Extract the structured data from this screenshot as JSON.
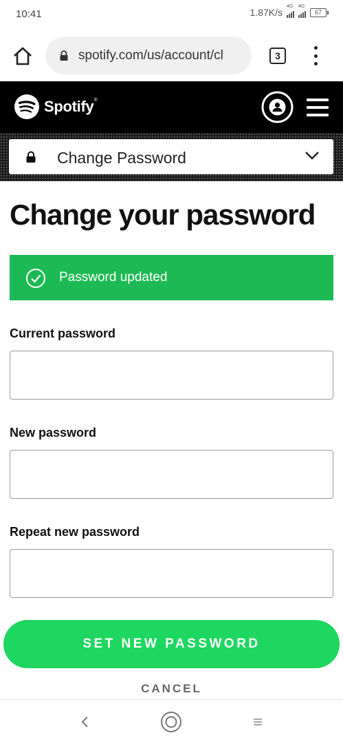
{
  "status_bar": {
    "time": "10:41",
    "net_speed": "1.87K/s",
    "signal_tag_1": "4G",
    "signal_tag_2": "4G",
    "battery": "67"
  },
  "browser": {
    "url": "spotify.com/us/account/cl",
    "tab_count": "3"
  },
  "header": {
    "logo_text": "Spotify"
  },
  "page_menu": {
    "selected": "Change Password"
  },
  "main": {
    "title": "Change your password",
    "alert": "Password updated",
    "fields": [
      {
        "label": "Current password",
        "value": ""
      },
      {
        "label": "New password",
        "value": ""
      },
      {
        "label": "Repeat new password",
        "value": ""
      }
    ],
    "submit_label": "SET NEW PASSWORD",
    "cancel_label": "CANCEL"
  },
  "colors": {
    "brand_green": "#1ed760",
    "alert_green": "#1db954",
    "header_bg": "#000000"
  }
}
